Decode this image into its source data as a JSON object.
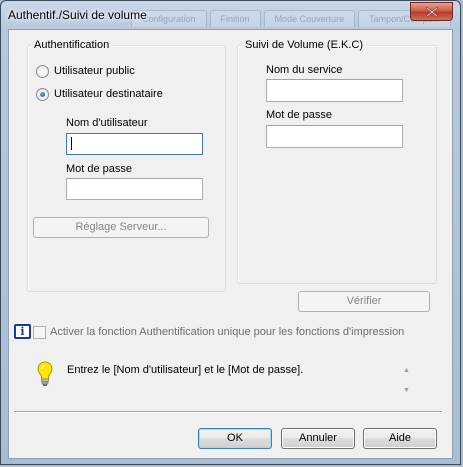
{
  "window": {
    "title": "Authentif./Suivi de volume",
    "ghost_tabs": [
      "Configuration",
      "Finition",
      "Mode Couverture",
      "Tampon/Compo..."
    ]
  },
  "auth_group": {
    "label": "Authentification",
    "radio_public": "Utilisateur public",
    "radio_recipient": "Utilisateur destinataire",
    "username_label": "Nom d'utilisateur",
    "username_value": "",
    "password_label": "Mot de passe",
    "password_value": "",
    "server_button": "Réglage Serveur..."
  },
  "volume_group": {
    "label": "Suivi de Volume (E.K.C)",
    "service_label": "Nom du service",
    "service_value": "",
    "password_label": "Mot de passe",
    "password_value": ""
  },
  "verify_button": "Vérifier",
  "sso_checkbox_label": "Activer la fonction Authentification unique pour les fonctions d'impression",
  "message": "Entrez le [Nom d'utilisateur] et le [Mot de passe].",
  "buttons": {
    "ok": "OK",
    "cancel": "Annuler",
    "help": "Aide"
  },
  "icons": {
    "close": "close-icon",
    "info": "info-icon",
    "lightbulb": "lightbulb-icon"
  }
}
